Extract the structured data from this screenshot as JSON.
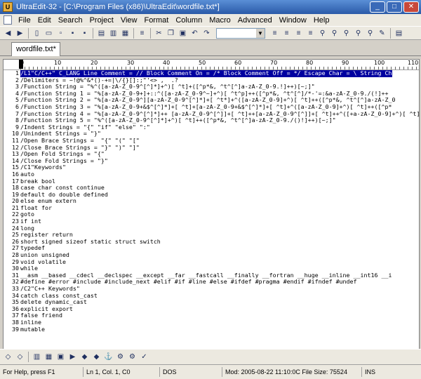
{
  "window": {
    "title": "UltraEdit-32 - [C:\\Program Files (x86)\\UltraEdit\\wordfile.txt*]"
  },
  "menu": [
    "File",
    "Edit",
    "Search",
    "Project",
    "View",
    "Format",
    "Column",
    "Macro",
    "Advanced",
    "Window",
    "Help"
  ],
  "tabs": [
    {
      "label": "wordfile.txt*"
    }
  ],
  "ruler": {
    "numbers": [
      "0",
      "10",
      "20",
      "30",
      "40",
      "50",
      "60",
      "70",
      "80",
      "90",
      "100",
      "110"
    ]
  },
  "editor": {
    "lines": [
      "/L1\"C/C++\" C_LANG Line Comment = // Block Comment On = /* Block Comment Off = */ Escape Char = \\ String Ch",
      "/Delimiters = ~!@%^&*()-+=|\\/{}[]:;\"'<> ,  .?",
      "/Function String = \"%^([a-zA-Z_0-9^[^]*]+^)[ ^t]+([^p*&, ^t^[^]a-zA-Z_0-9.!]++)[~;]\"",
      "/Function String 1 = \"%[a-zA-Z_0-9+]+::^([a-zA-Z_0-9^~]+^)[ ^t^p]++([^p*&, ^t^[^]/*-'=:&a-zA-Z_0-9./(!]++",
      "/Function String 2 = \"%[a-zA-Z_0-9^][a-zA-Z_0-9^[^]*]+[ ^t*]+^([a-zA-Z_0-9]+^)[ ^t]++([^p*&, ^t^[^]a-zA-Z_0",
      "/Function String 3 = \"%[a-zA-Z_0-9+&$^[^]*]+[ ^t]+[a-zA-Z_0-9+&$^[^]*]+[ ^t]+^([a-zA-Z_0-9]+^)[ ^t]++([^p*",
      "/Function String 4 = \"%[a-zA-Z_0-9^[^]*]++ [a-zA-Z_0-9^[^]]+[ ^t]++[a-zA-Z_0-9^[^]]+[ ^t]++^([+a-zA-Z_0-9]+^)[ ^t]++",
      "/Function String 5 = \"%^([a-zA-Z_0-9^[^]*]+^)[ ^t]++([^p*&, ^t^[^]a-zA-Z_0-9./()!]++)[~;]\"",
      "/Indent Strings = \"{\" \"if\" \"else\" \":\"",
      "/Unindent Strings = \"}\"",
      "/Open Brace Strings =  \"{\" \"(\" \"[\"",
      "/Close Brace Strings = \"}\" \")\" \"]\"",
      "/Open Fold Strings = \"{\"",
      "/Close Fold Strings = \"}\"",
      "/C1\"Keywords\"",
      "auto",
      "break bool",
      "case char const continue",
      "default do double defined",
      "else enum extern",
      "float for",
      "goto",
      "if int",
      "long",
      "register return",
      "short signed sizeof static struct switch",
      "typedef",
      "union unsigned",
      "void volatile",
      "while",
      "__asm __based __cdecl __declspec __except __far __fastcall __finally __fortran __huge __inline __int16 __i",
      "#define #error #include #include_next #elif #if #line #else #ifdef #pragma #endif #ifndef #undef",
      "/C2\"C++ Keywords\"",
      "catch class const_cast",
      "delete dynamic_cast",
      "explicit export",
      "false friend",
      "inline",
      "mutable"
    ]
  },
  "status": {
    "help": "For Help, press F1",
    "position": "Ln 1, Col. 1, C0",
    "format": "DOS",
    "modified": "Mod: 2005-08-22 11:10:0C File Size: 75524",
    "ins": "INS"
  },
  "colors": {
    "titlebar": "#2a5aa8",
    "selection": "#0000a0"
  }
}
